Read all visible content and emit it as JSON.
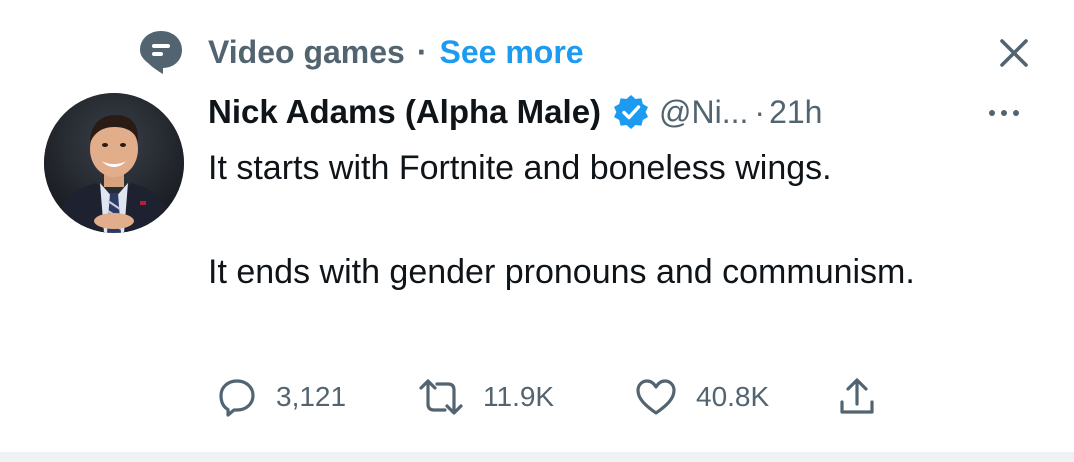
{
  "context": {
    "topic_icon": "topic-speech-bubble-icon",
    "topic_label": "Video games",
    "separator": "·",
    "see_more_label": "See more",
    "close_icon": "close-icon"
  },
  "author": {
    "display_name": "Nick Adams (Alpha Male)",
    "verified_icon": "verified-badge-icon",
    "handle": "@Ni...",
    "separator": "·",
    "timestamp": "21h",
    "more_icon": "more-horizontal-icon"
  },
  "tweet": {
    "paragraphs": [
      "It starts with Fortnite and boneless wings.",
      "It ends with gender pronouns and communism."
    ]
  },
  "actions": {
    "reply": {
      "icon": "reply-icon",
      "count": "3,121"
    },
    "retweet": {
      "icon": "retweet-icon",
      "count": "11.9K"
    },
    "like": {
      "icon": "heart-icon",
      "count": "40.8K"
    },
    "share": {
      "icon": "share-icon"
    }
  },
  "colors": {
    "text_primary": "#0f1419",
    "text_secondary": "#536471",
    "link_blue": "#1d9bf0",
    "background": "#ffffff",
    "bottom_strip": "#eff1f3"
  }
}
